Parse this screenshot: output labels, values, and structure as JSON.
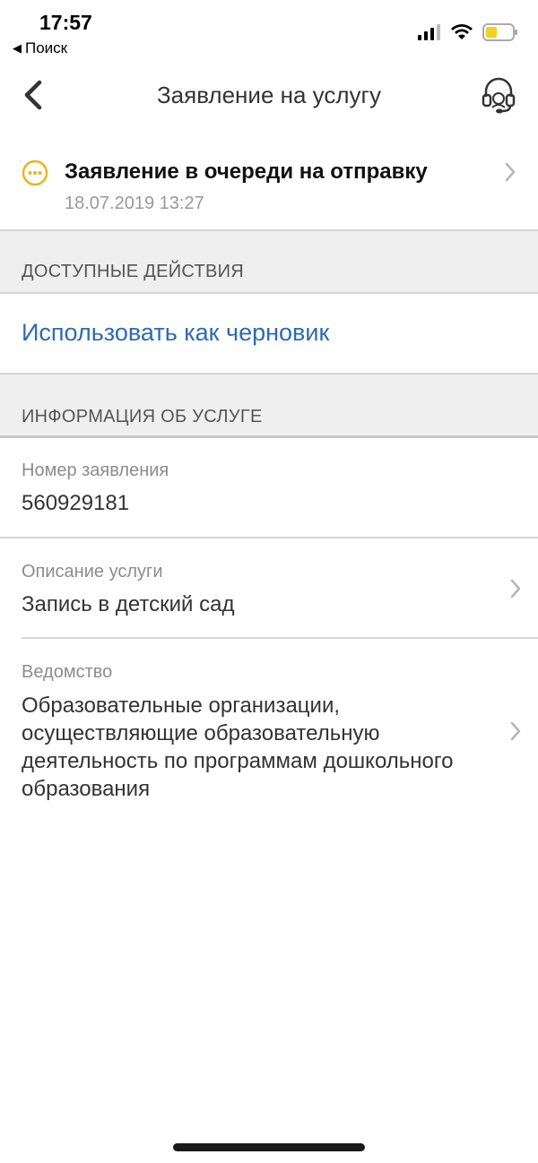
{
  "status_bar": {
    "time": "17:57",
    "back_label": "Поиск",
    "back_icon": "triangle-left"
  },
  "nav": {
    "title": "Заявление на услугу",
    "back_icon": "chevron-left",
    "support_icon": "headset"
  },
  "application_status": {
    "icon": "ellipsis-circle",
    "icon_color": "#e6b81e",
    "title": "Заявление в очереди на отправку",
    "date": "18.07.2019 13:27"
  },
  "actions_section": {
    "header": "ДОСТУПНЫЕ ДЕЙСТВИЯ",
    "items": [
      {
        "label": "Использовать как черновик"
      }
    ]
  },
  "info_section": {
    "header": "ИНФОРМАЦИЯ ОБ УСЛУГЕ",
    "rows": [
      {
        "caption": "Номер заявления",
        "value": "560929181"
      },
      {
        "caption": "Описание услуги",
        "value": "Запись в детский сад"
      },
      {
        "caption": "Ведомство",
        "value": "Образовательные организации, осуществляющие образовательную деятельность по программам дошкольного образования"
      }
    ]
  },
  "colors": {
    "accent_link": "#2d6bb0",
    "status_pending": "#e6b81e",
    "section_bg": "#efefef"
  }
}
